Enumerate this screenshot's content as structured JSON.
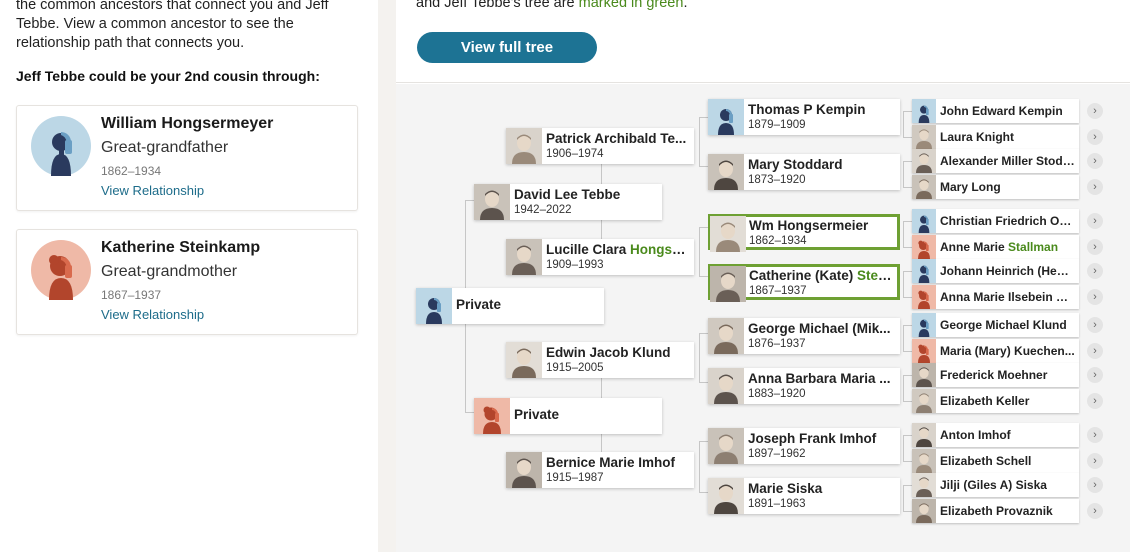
{
  "left": {
    "intro": "the common ancestors that connect you and Jeff Tebbe. View a common ancestor to see the relationship path that connects you.",
    "cousin_heading": "Jeff Tebbe could be your 2nd cousin through:",
    "ancestors": [
      {
        "name": "William Hongsermeyer",
        "relation": "Great-grandfather",
        "years": "1862–1934",
        "link": "View Relationship",
        "gender": "male"
      },
      {
        "name": "Katherine Steinkamp",
        "relation": "Great-grandmother",
        "years": "1867–1937",
        "link": "View Relationship",
        "gender": "female"
      }
    ]
  },
  "right": {
    "top_note_prefix": "and Jeff Tebbe's tree are ",
    "top_note_green": "marked in green",
    "top_note_suffix": ".",
    "view_full_tree": "View full tree"
  },
  "colors": {
    "accent": "#1d7394",
    "green": "#4a8a1c",
    "link": "#1d6c8a"
  },
  "tree": {
    "root": {
      "name": "Private",
      "gender": "male"
    },
    "gen1": [
      {
        "name": "David Lee Tebbe",
        "years": "1942–2022",
        "photo": true
      },
      {
        "name": "Private",
        "gender": "female"
      }
    ],
    "gen2": [
      {
        "name": "Patrick Archibald Te...",
        "years": "1906–1974",
        "photo": true
      },
      {
        "name_plain": "Lucille Clara ",
        "name_green": "Hongse...",
        "years": "1909–1993",
        "photo": true
      },
      {
        "name": "Edwin Jacob Klund",
        "years": "1915–2005",
        "photo": true
      },
      {
        "name": "Bernice Marie Imhof",
        "years": "1915–1987",
        "photo": true
      }
    ],
    "gen3": [
      {
        "name": "Thomas P Kempin",
        "years": "1879–1909",
        "gender": "male"
      },
      {
        "name": "Mary Stoddard",
        "years": "1873–1920",
        "photo": true
      },
      {
        "name": "Wm Hongsermeier",
        "years": "1862–1934",
        "photo": true,
        "highlight": true
      },
      {
        "name_plain": "Catherine (Kate) ",
        "name_green": "Stei...",
        "years": "1867–1937",
        "photo": true,
        "highlight": true
      },
      {
        "name": "George Michael (Mik...",
        "years": "1876–1937",
        "photo": true
      },
      {
        "name": "Anna Barbara Maria ...",
        "years": "1883–1920",
        "photo": true
      },
      {
        "name": "Joseph Frank Imhof",
        "years": "1897–1962",
        "photo": true
      },
      {
        "name": "Marie Siska",
        "years": "1891–1963",
        "photo": true
      }
    ],
    "gen4": [
      {
        "name": "John Edward Kempin",
        "gender": "male"
      },
      {
        "name": "Laura Knight",
        "photo": true
      },
      {
        "name": "Alexander Miller Stodd...",
        "photo": true
      },
      {
        "name": "Mary Long",
        "photo": true
      },
      {
        "name": "Christian Friedrich Ob...",
        "gender": "male"
      },
      {
        "name_plain": "Anne Marie ",
        "name_green": "Stallman",
        "gender": "female"
      },
      {
        "name": "Johann Heinrich (Henr...",
        "gender": "male"
      },
      {
        "name": "Anna Marie Ilsebein Ei...",
        "gender": "female"
      },
      {
        "name": "George Michael Klund",
        "gender": "male"
      },
      {
        "name": "Maria (Mary) Kuechen...",
        "gender": "female"
      },
      {
        "name": "Frederick Moehner",
        "photo": true
      },
      {
        "name": "Elizabeth Keller",
        "photo": true
      },
      {
        "name": "Anton Imhof",
        "photo": true
      },
      {
        "name": "Elizabeth Schell",
        "photo": true
      },
      {
        "name": "Jilji (Giles A) Siska",
        "photo": true
      },
      {
        "name": "Elizabeth Provaznik",
        "photo": true
      }
    ],
    "expand_icon": "chevron-right-icon"
  }
}
